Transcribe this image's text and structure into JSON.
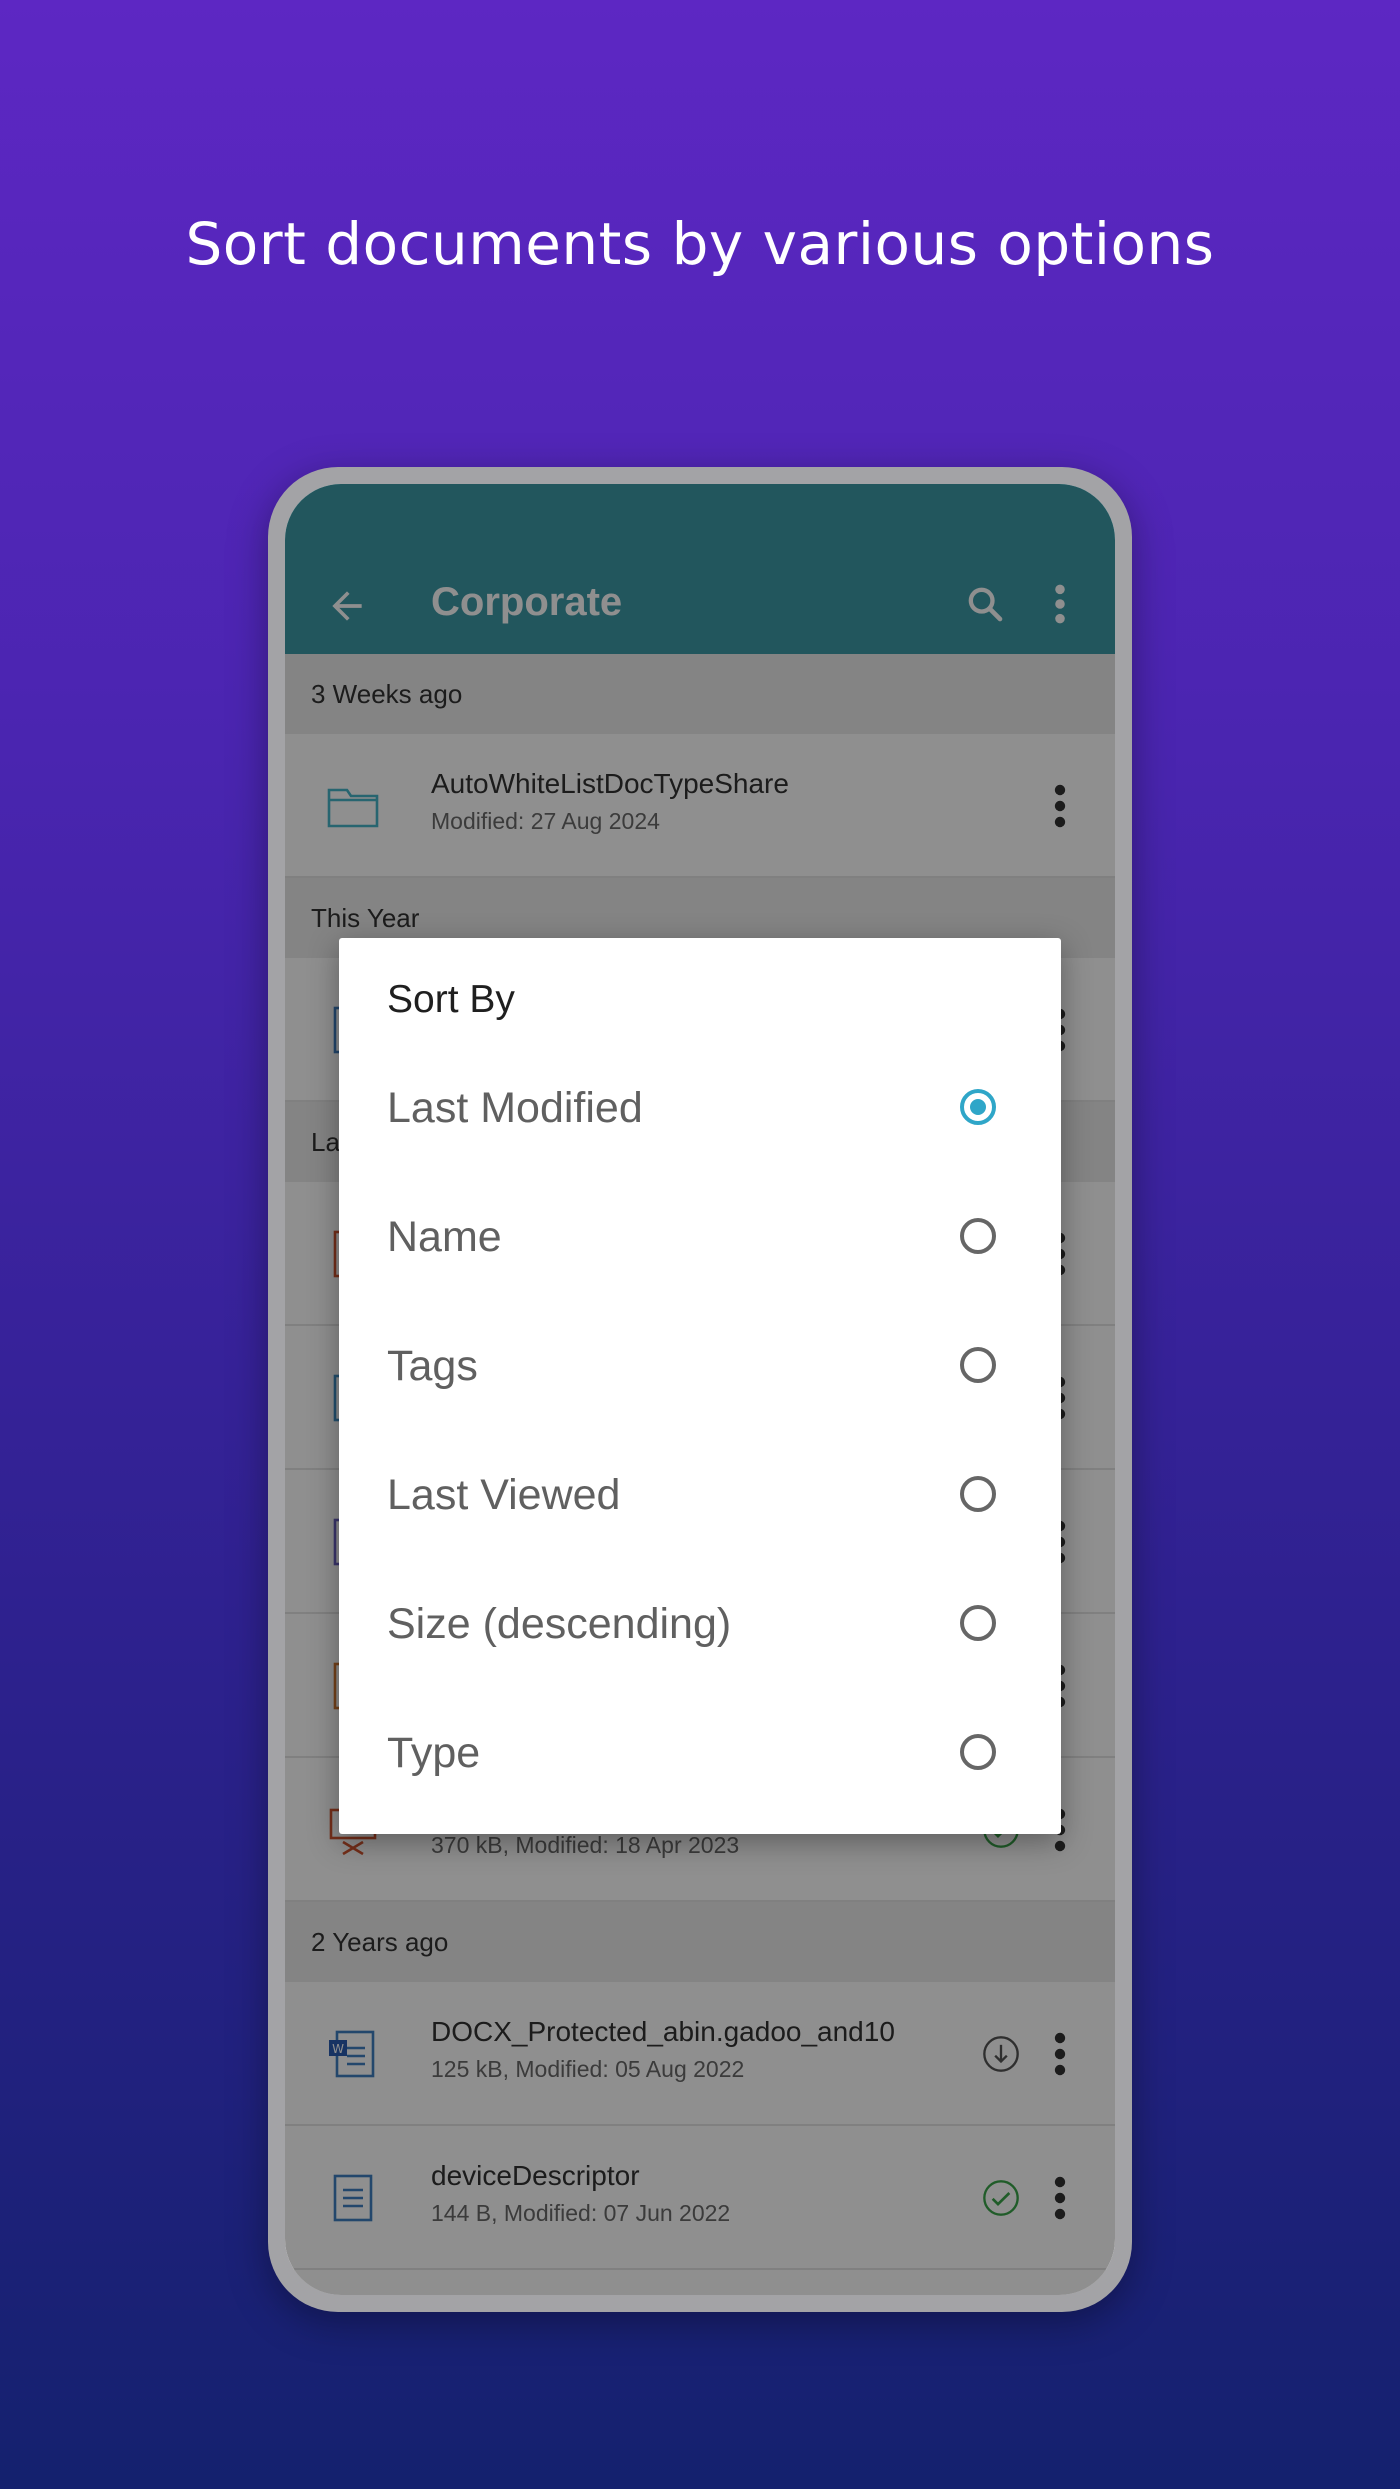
{
  "headline": "Sort documents by various options",
  "appbar": {
    "title": "Corporate"
  },
  "sections": [
    {
      "header": "3 Weeks ago",
      "items": [
        {
          "name": "AutoWhiteListDocTypeShare",
          "meta": "Modified: 27 Aug 2024",
          "icon": "folder-icon",
          "status": ""
        }
      ]
    },
    {
      "header": "This Year",
      "items": [
        {
          "name": "",
          "meta": "",
          "icon": "document-icon",
          "status": ""
        }
      ]
    },
    {
      "header": "La",
      "items": [
        {
          "name": "",
          "meta": "",
          "icon": "pdf-file-icon",
          "status": ""
        },
        {
          "name": "",
          "meta": "",
          "icon": "image-file-icon",
          "status": ""
        },
        {
          "name": "",
          "meta": "",
          "icon": "document-icon",
          "status": ""
        },
        {
          "name": "",
          "meta": "",
          "icon": "presentation-file-icon",
          "status": ""
        },
        {
          "name": "",
          "meta": "370 kB, Modified: 18 Apr 2023",
          "icon": "presentation-file-icon",
          "status": "downloaded"
        }
      ]
    },
    {
      "header": "2 Years ago",
      "items": [
        {
          "name": "DOCX_Protected_abin.gadoo_and10",
          "meta": "125 kB, Modified: 05 Aug 2022",
          "icon": "word-file-icon",
          "status": "download"
        },
        {
          "name": "deviceDescriptor",
          "meta": "144 B, Modified: 07 Jun 2022",
          "icon": "text-file-icon",
          "status": "downloaded"
        }
      ]
    }
  ],
  "dialog": {
    "title": "Sort By",
    "options": [
      {
        "label": "Last Modified",
        "selected": true
      },
      {
        "label": "Name",
        "selected": false
      },
      {
        "label": "Tags",
        "selected": false
      },
      {
        "label": "Last Viewed",
        "selected": false
      },
      {
        "label": "Size (descending)",
        "selected": false
      },
      {
        "label": "Type",
        "selected": false
      }
    ]
  },
  "colors": {
    "appbar": "#3e9aa7",
    "radio_selected": "#2fa6c8",
    "status_ok": "#3aa54a"
  }
}
